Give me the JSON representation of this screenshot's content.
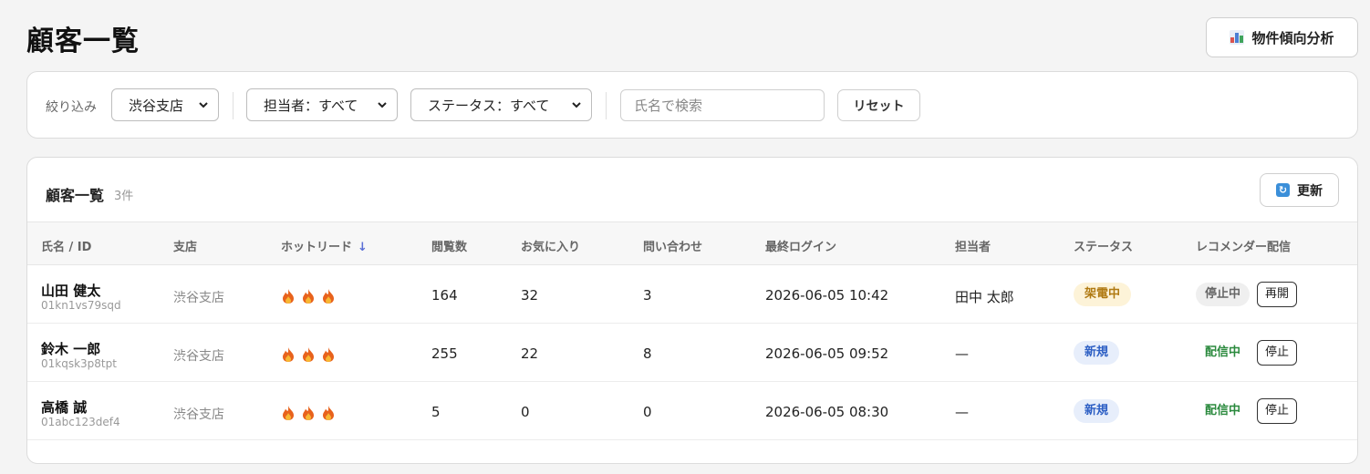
{
  "page": {
    "title": "顧客一覧"
  },
  "toolbar": {
    "analysis_label": "物件傾向分析",
    "analysis_icon": "bar-chart-icon"
  },
  "filters": {
    "label": "絞り込み",
    "branch_value": "渋谷支店",
    "rep_value": "担当者：すべて",
    "status_value": "ステータス：すべて",
    "search_placeholder": "氏名で検索",
    "reset_label": "リセット"
  },
  "list": {
    "title": "顧客一覧",
    "count": "3件",
    "refresh_label": "更新",
    "columns": [
      "氏名 / ID",
      "支店",
      "ホットリード",
      "閲覧数",
      "お気に入り",
      "問い合わせ",
      "最終ログイン",
      "担当者",
      "ステータス",
      "レコメンダー配信"
    ],
    "sort_indicator": "↓",
    "rows": [
      {
        "name": "山田 健太",
        "id": "01kn1vs79sqd",
        "branch": "渋谷支店",
        "hot_level": 3,
        "views": "164",
        "favorites": "32",
        "inquiries": "3",
        "last_login": "2026-06-05 10:42",
        "rep": "田中 太郎",
        "status": "架電中",
        "rec_status": "停止中",
        "rec_action": "再開"
      },
      {
        "name": "鈴木 一郎",
        "id": "01kqsk3p8tpt",
        "branch": "渋谷支店",
        "hot_level": 3,
        "views": "255",
        "favorites": "22",
        "inquiries": "8",
        "last_login": "2026-06-05 09:52",
        "rep": "—",
        "status": "新規",
        "rec_status": "配信中",
        "rec_action": "停止"
      },
      {
        "name": "高橋 誠",
        "id": "01abc123def4",
        "branch": "渋谷支店",
        "hot_level": 3,
        "views": "5",
        "favorites": "0",
        "inquiries": "0",
        "last_login": "2026-06-05 08:30",
        "rep": "—",
        "status": "新規",
        "rec_status": "配信中",
        "rec_action": "停止"
      }
    ]
  },
  "colors": {
    "accent_blue": "#2d5fc4",
    "calling": "#b07a12",
    "active": "#2b8a3e",
    "flame": "#e8621c"
  }
}
